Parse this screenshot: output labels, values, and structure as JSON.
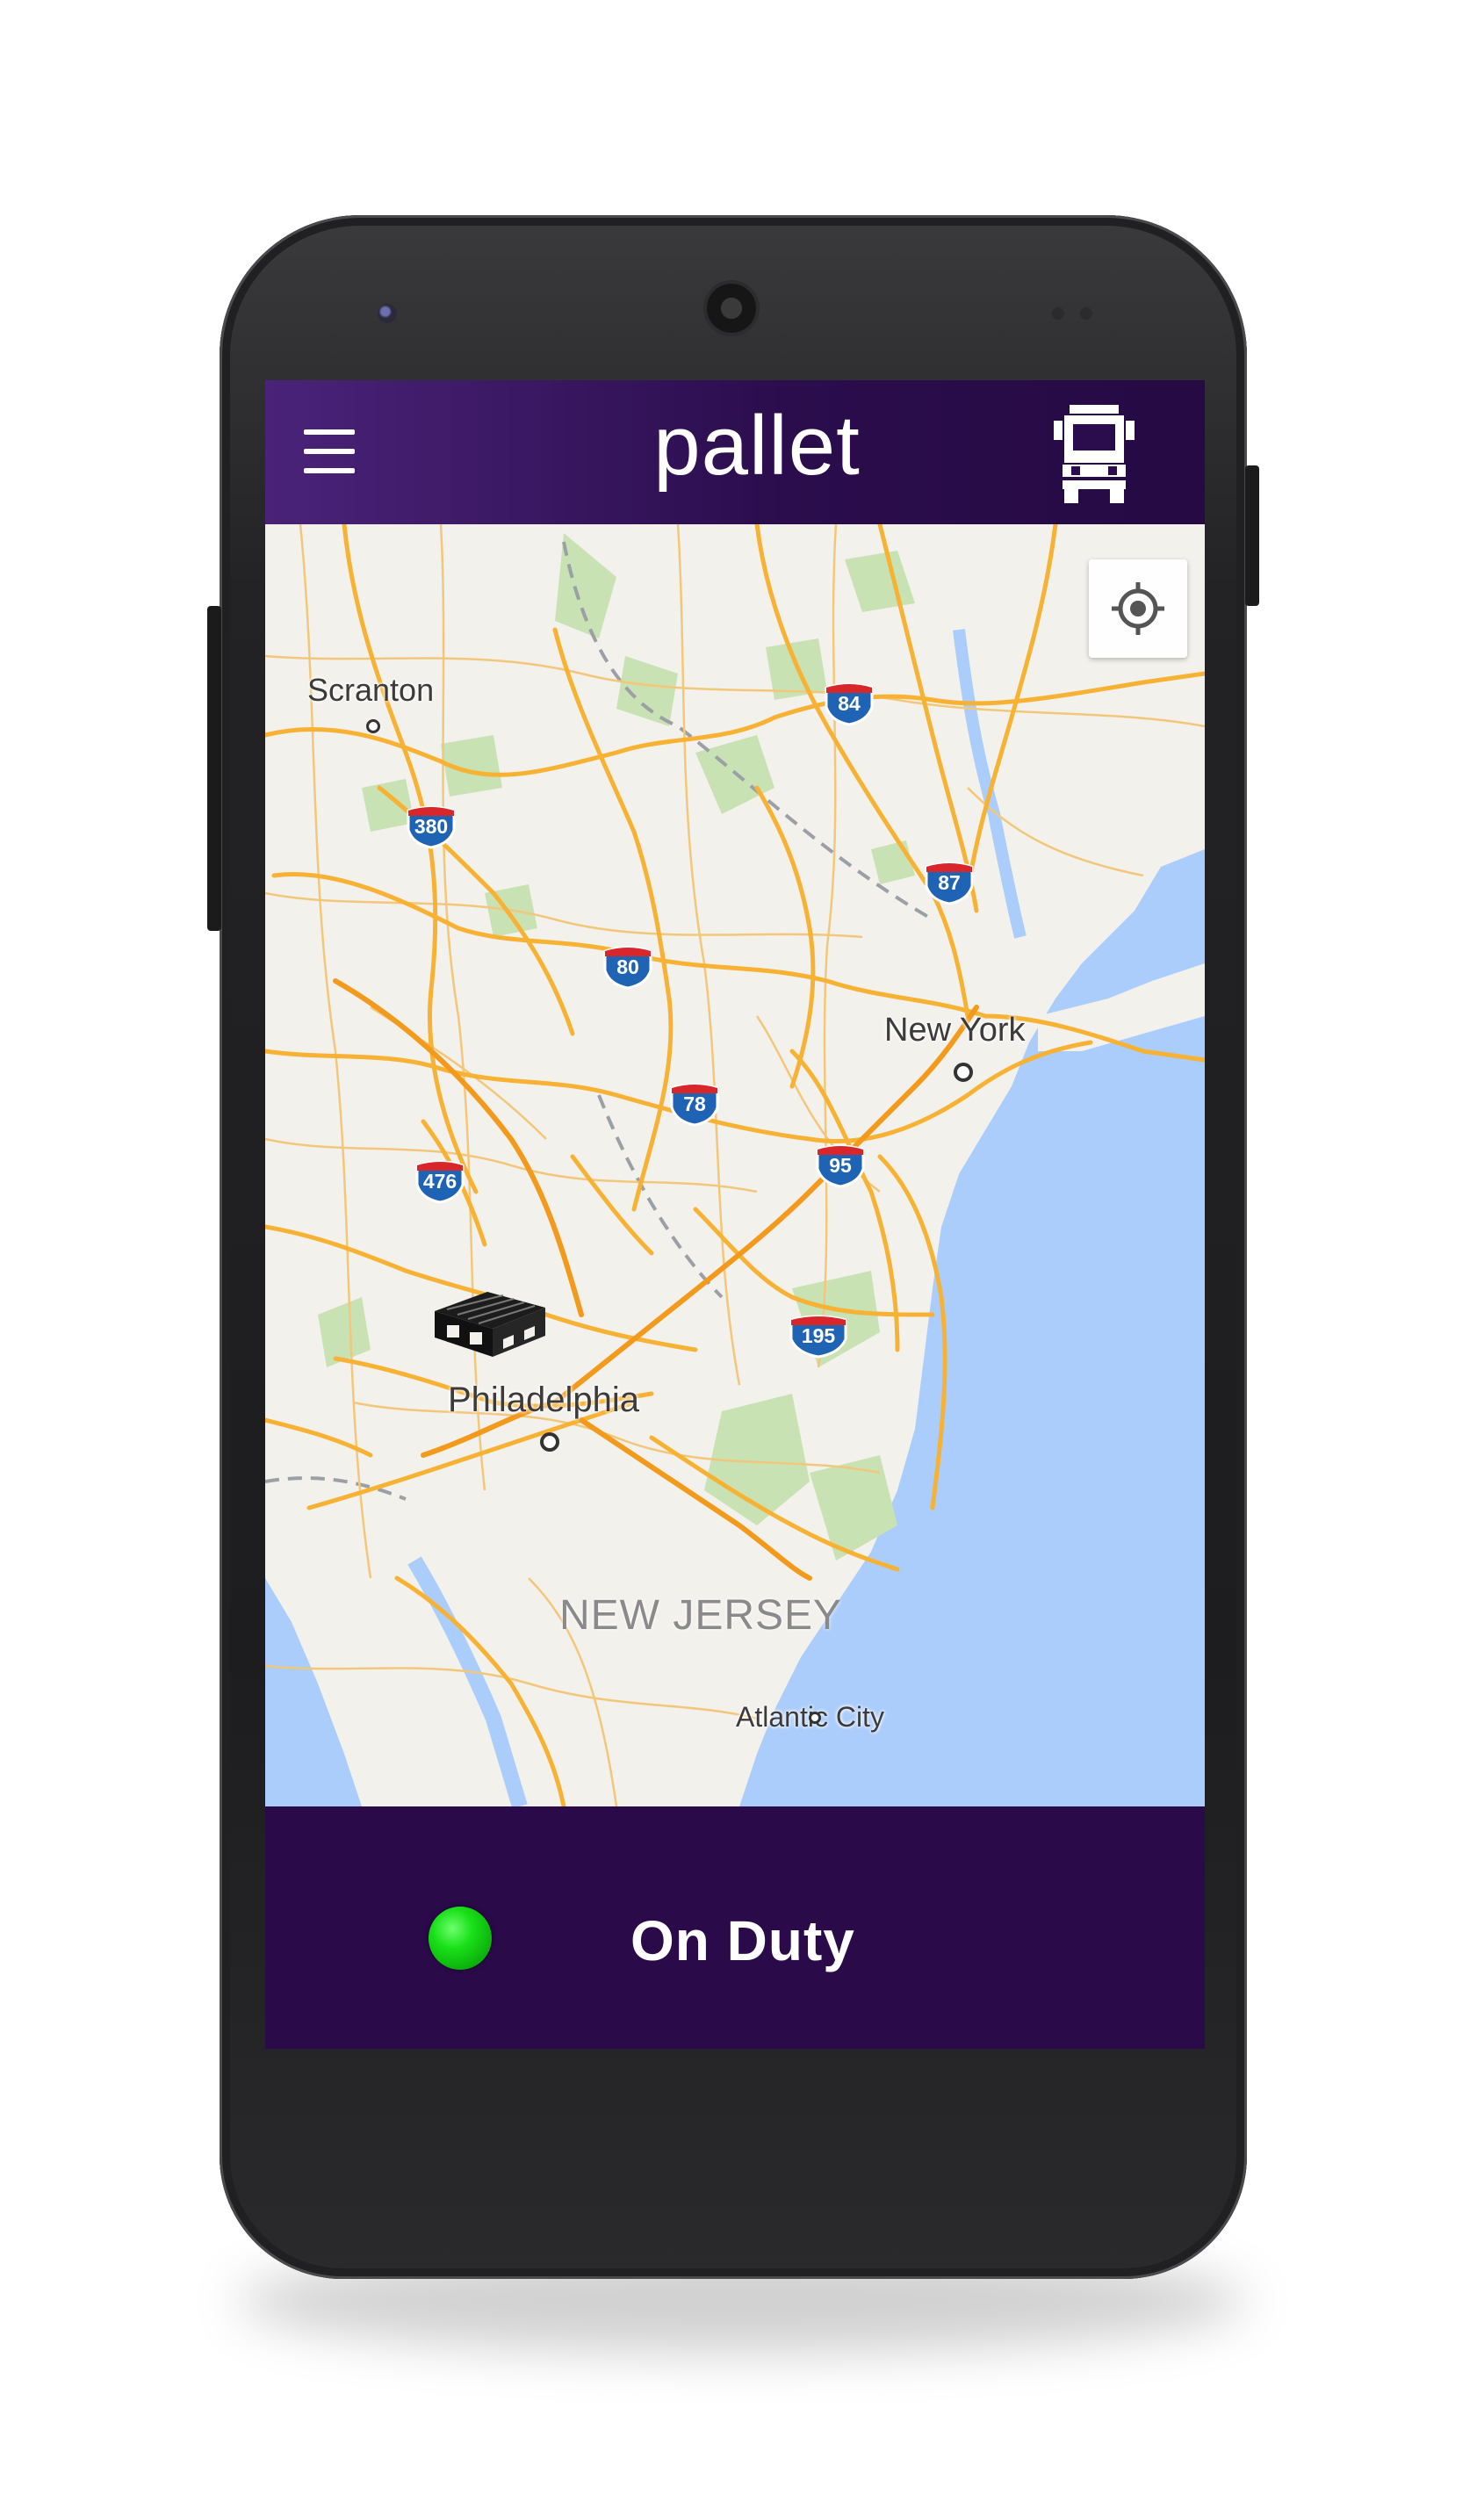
{
  "header": {
    "title": "pallet",
    "menu_icon": "hamburger-menu-icon",
    "truck_icon": "truck-icon"
  },
  "map": {
    "locate_icon": "my-location-icon",
    "cities": [
      {
        "name": "Scranton"
      },
      {
        "name": "New York"
      },
      {
        "name": "Philadelphia"
      },
      {
        "name": "Atlantic City"
      }
    ],
    "state_label": "NEW JERSEY",
    "highways": [
      "84",
      "380",
      "87",
      "80",
      "78",
      "476",
      "95",
      "195"
    ],
    "marker_icon": "pallet-icon",
    "colors": {
      "water": "#abcdfb",
      "land": "#f3f1ec",
      "parks": "#c8e2b4",
      "roads": "#f7b234",
      "shield_blue": "#1f64b4",
      "shield_red": "#d8262b"
    }
  },
  "status_bar": {
    "label": "On Duty",
    "indicator_color": "#19e019",
    "background": "#2b0a4a"
  }
}
